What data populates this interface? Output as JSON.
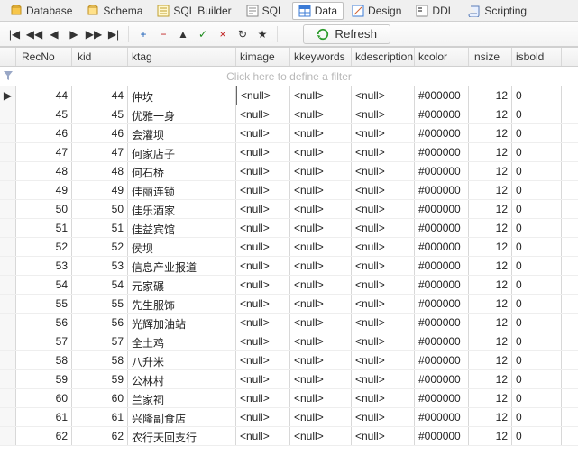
{
  "tabs": [
    {
      "label": "Database",
      "icon": "db"
    },
    {
      "label": "Schema",
      "icon": "schema"
    },
    {
      "label": "SQL Builder",
      "icon": "builder"
    },
    {
      "label": "SQL",
      "icon": "sql"
    },
    {
      "label": "Data",
      "icon": "data",
      "active": true
    },
    {
      "label": "Design",
      "icon": "design"
    },
    {
      "label": "DDL",
      "icon": "ddl"
    },
    {
      "label": "Scripting",
      "icon": "script"
    }
  ],
  "nav": {
    "first": "|◀",
    "prevpage": "◀◀",
    "prev": "◀",
    "next": "▶",
    "nextpage": "▶▶",
    "last": "▶|",
    "add": "+",
    "delete": "−",
    "edit": "▲",
    "post": "✓",
    "cancel": "×",
    "refresh_small": "↻",
    "bookmark": "★"
  },
  "refresh_label": "Refresh",
  "columns": {
    "recno": "RecNo",
    "kid": "kid",
    "ktag": "ktag",
    "kimage": "kimage",
    "kkeywords": "kkeywords",
    "kdescription": "kdescription",
    "kcolor": "kcolor",
    "nsize": "nsize",
    "isbold": "isbold"
  },
  "filter_placeholder": "Click here to define a filter",
  "null_text": "<null>",
  "rows": [
    {
      "recno": 44,
      "kid": 44,
      "ktag": "仲坎",
      "kcolor": "#000000",
      "nsize": 12,
      "isbold": 0,
      "current": true
    },
    {
      "recno": 45,
      "kid": 45,
      "ktag": "优雅一身",
      "kcolor": "#000000",
      "nsize": 12,
      "isbold": 0
    },
    {
      "recno": 46,
      "kid": 46,
      "ktag": "会灌坝",
      "kcolor": "#000000",
      "nsize": 12,
      "isbold": 0
    },
    {
      "recno": 47,
      "kid": 47,
      "ktag": "何家店子",
      "kcolor": "#000000",
      "nsize": 12,
      "isbold": 0
    },
    {
      "recno": 48,
      "kid": 48,
      "ktag": "何石桥",
      "kcolor": "#000000",
      "nsize": 12,
      "isbold": 0
    },
    {
      "recno": 49,
      "kid": 49,
      "ktag": "佳丽连锁",
      "kcolor": "#000000",
      "nsize": 12,
      "isbold": 0
    },
    {
      "recno": 50,
      "kid": 50,
      "ktag": "佳乐酒家",
      "kcolor": "#000000",
      "nsize": 12,
      "isbold": 0
    },
    {
      "recno": 51,
      "kid": 51,
      "ktag": "佳益宾馆",
      "kcolor": "#000000",
      "nsize": 12,
      "isbold": 0
    },
    {
      "recno": 52,
      "kid": 52,
      "ktag": "侯坝",
      "kcolor": "#000000",
      "nsize": 12,
      "isbold": 0
    },
    {
      "recno": 53,
      "kid": 53,
      "ktag": "信息产业报道",
      "kcolor": "#000000",
      "nsize": 12,
      "isbold": 0
    },
    {
      "recno": 54,
      "kid": 54,
      "ktag": "元家碾",
      "kcolor": "#000000",
      "nsize": 12,
      "isbold": 0
    },
    {
      "recno": 55,
      "kid": 55,
      "ktag": "先生服饰",
      "kcolor": "#000000",
      "nsize": 12,
      "isbold": 0
    },
    {
      "recno": 56,
      "kid": 56,
      "ktag": "光辉加油站",
      "kcolor": "#000000",
      "nsize": 12,
      "isbold": 0
    },
    {
      "recno": 57,
      "kid": 57,
      "ktag": "全土鸡",
      "kcolor": "#000000",
      "nsize": 12,
      "isbold": 0
    },
    {
      "recno": 58,
      "kid": 58,
      "ktag": "八升米",
      "kcolor": "#000000",
      "nsize": 12,
      "isbold": 0
    },
    {
      "recno": 59,
      "kid": 59,
      "ktag": "公林村",
      "kcolor": "#000000",
      "nsize": 12,
      "isbold": 0
    },
    {
      "recno": 60,
      "kid": 60,
      "ktag": "兰家祠",
      "kcolor": "#000000",
      "nsize": 12,
      "isbold": 0
    },
    {
      "recno": 61,
      "kid": 61,
      "ktag": "兴隆副食店",
      "kcolor": "#000000",
      "nsize": 12,
      "isbold": 0
    },
    {
      "recno": 62,
      "kid": 62,
      "ktag": "农行天回支行",
      "kcolor": "#000000",
      "nsize": 12,
      "isbold": 0
    }
  ]
}
